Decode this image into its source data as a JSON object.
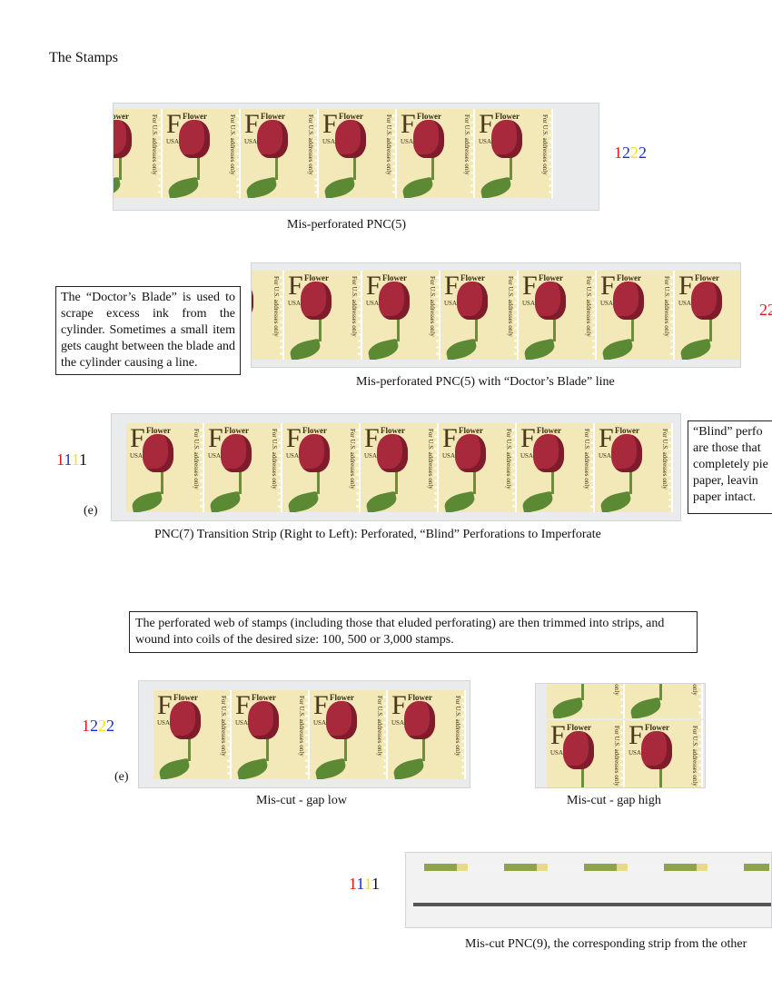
{
  "page": {
    "title": "The Stamps"
  },
  "stamp_text": {
    "denomination": "F",
    "label": "Flower",
    "country": "USA",
    "side": "For U.S. addresses only"
  },
  "section1": {
    "caption": "Mis-perforated PNC(5)",
    "digits": [
      "1",
      "2",
      "2",
      "2"
    ]
  },
  "section2": {
    "caption": "Mis-perforated PNC(5) with “Doctor’s Blade” line",
    "note": "The “Doctor’s Blade” is used to scrape excess ink from the cylinder. Sometimes a small item gets caught between the blade and the cylinder causing a line.",
    "digits": [
      "2",
      "2"
    ]
  },
  "section3": {
    "caption": "PNC(7) Transition Strip (Right to Left): Perforated, “Blind” Perforations to Imperforate",
    "digits": [
      "1",
      "1",
      "1",
      "1"
    ],
    "e_note": "(e)",
    "blind_note": [
      "“Blind” perfo",
      "are those that",
      "completely pie",
      "paper, leavin",
      "paper intact."
    ]
  },
  "section4": {
    "note": "The perforated web of stamps (including those that eluded perforating) are then trimmed into strips, and wound into coils of the desired size: 100, 500 or 3,000 stamps.",
    "digits": [
      "1",
      "2",
      "2",
      "2"
    ],
    "e_note": "(e)",
    "caption_low": "Mis-cut - gap low",
    "caption_high": "Mis-cut - gap high"
  },
  "section5": {
    "digits": [
      "1",
      "1",
      "1",
      "1"
    ],
    "caption": "Mis-cut PNC(9), the corresponding strip from the other"
  },
  "colors": {
    "red": "#e01a1a",
    "blue": "#1a2fd6",
    "yellow": "#f2e21a",
    "black": "#111111"
  }
}
